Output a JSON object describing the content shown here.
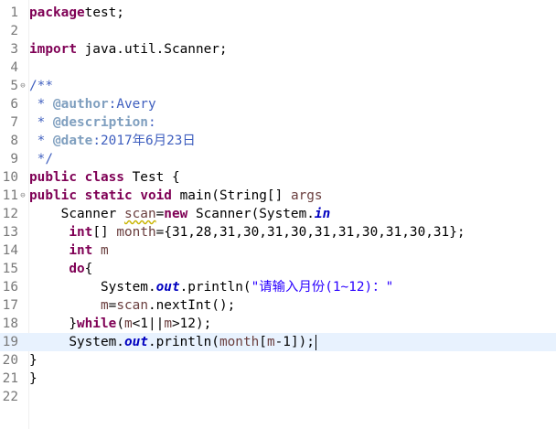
{
  "editor": {
    "current_line": 19,
    "lines": [
      {
        "n": "1",
        "fold": "",
        "tokens": [
          [
            "kw",
            "package"
          ],
          [
            "",
            "test;"
          ]
        ]
      },
      {
        "n": "2",
        "fold": "",
        "tokens": []
      },
      {
        "n": "3",
        "fold": "",
        "tokens": [
          [
            "kw",
            "import"
          ],
          [
            "",
            " java.util.Scanner;"
          ]
        ]
      },
      {
        "n": "4",
        "fold": "",
        "tokens": []
      },
      {
        "n": "5",
        "fold": "⊖",
        "tokens": [
          [
            "cm",
            "/**"
          ]
        ]
      },
      {
        "n": "6",
        "fold": "",
        "tokens": [
          [
            "cm",
            " * "
          ],
          [
            "tag",
            "@author"
          ],
          [
            "cm",
            ":Avery"
          ]
        ]
      },
      {
        "n": "7",
        "fold": "",
        "tokens": [
          [
            "cm",
            " * "
          ],
          [
            "tag",
            "@description"
          ],
          [
            "cm",
            ":"
          ]
        ]
      },
      {
        "n": "8",
        "fold": "",
        "tokens": [
          [
            "cm",
            " * "
          ],
          [
            "tag",
            "@date"
          ],
          [
            "cm",
            ":2017年6月23日"
          ]
        ]
      },
      {
        "n": "9",
        "fold": "",
        "tokens": [
          [
            "cm",
            " */"
          ]
        ]
      },
      {
        "n": "10",
        "fold": "",
        "tokens": [
          [
            "kw",
            "public"
          ],
          [
            "",
            " "
          ],
          [
            "kw",
            "class"
          ],
          [
            "",
            " Test {"
          ]
        ]
      },
      {
        "n": "11",
        "fold": "⊖",
        "tokens": [
          [
            "kw",
            "public"
          ],
          [
            "",
            " "
          ],
          [
            "kw",
            "static"
          ],
          [
            "",
            " "
          ],
          [
            "kw",
            "void"
          ],
          [
            "",
            " main(String[] "
          ],
          [
            "var",
            "args"
          ],
          [
            ") {"
          ]
        ]
      },
      {
        "n": "12",
        "fold": "",
        "tokens": [
          [
            "",
            "    Scanner "
          ],
          [
            "varw",
            "scan"
          ],
          [
            "",
            "="
          ],
          [
            "kw",
            "new"
          ],
          [
            "",
            " Scanner(System."
          ],
          [
            "fld",
            "in"
          ],
          [
            ");"
          ]
        ]
      },
      {
        "n": "13",
        "fold": "",
        "tokens": [
          [
            "",
            "     "
          ],
          [
            "kw",
            "int"
          ],
          [
            "",
            "[] "
          ],
          [
            "var",
            "month"
          ],
          [
            "",
            "={31,28,31,30,31,30,31,31,30,31,30,31};"
          ]
        ]
      },
      {
        "n": "14",
        "fold": "",
        "tokens": [
          [
            "",
            "     "
          ],
          [
            "kw",
            "int"
          ],
          [
            "",
            " "
          ],
          [
            "var",
            "m"
          ],
          [
            ";"
          ]
        ]
      },
      {
        "n": "15",
        "fold": "",
        "tokens": [
          [
            "",
            "     "
          ],
          [
            "kw",
            "do"
          ],
          [
            "",
            "{"
          ]
        ]
      },
      {
        "n": "16",
        "fold": "",
        "tokens": [
          [
            "",
            "         System."
          ],
          [
            "fld",
            "out"
          ],
          [
            "",
            ".println("
          ],
          [
            "str",
            "\"请输入月份(1~12)：\""
          ],
          [
            ");"
          ]
        ]
      },
      {
        "n": "17",
        "fold": "",
        "tokens": [
          [
            "",
            "         "
          ],
          [
            "var",
            "m"
          ],
          [
            "",
            "="
          ],
          [
            "var",
            "scan"
          ],
          [
            "",
            ".nextInt();"
          ]
        ]
      },
      {
        "n": "18",
        "fold": "",
        "tokens": [
          [
            "",
            "     }"
          ],
          [
            "kw",
            "while"
          ],
          [
            "",
            "("
          ],
          [
            "var",
            "m"
          ],
          [
            "",
            "<1||"
          ],
          [
            "var",
            "m"
          ],
          [
            "",
            ">12);"
          ]
        ]
      },
      {
        "n": "19",
        "fold": "",
        "tokens": [
          [
            "",
            "     System."
          ],
          [
            "fld",
            "out"
          ],
          [
            "",
            ".println("
          ],
          [
            "var",
            "month"
          ],
          [
            "",
            "["
          ],
          [
            "var",
            "m"
          ],
          [
            "",
            "-1]);"
          ],
          [
            "caret",
            ""
          ]
        ]
      },
      {
        "n": "20",
        "fold": "",
        "tokens": [
          [
            "",
            "}"
          ]
        ]
      },
      {
        "n": "21",
        "fold": "",
        "tokens": [
          [
            "",
            "}"
          ]
        ]
      },
      {
        "n": "22",
        "fold": "",
        "tokens": []
      }
    ]
  }
}
